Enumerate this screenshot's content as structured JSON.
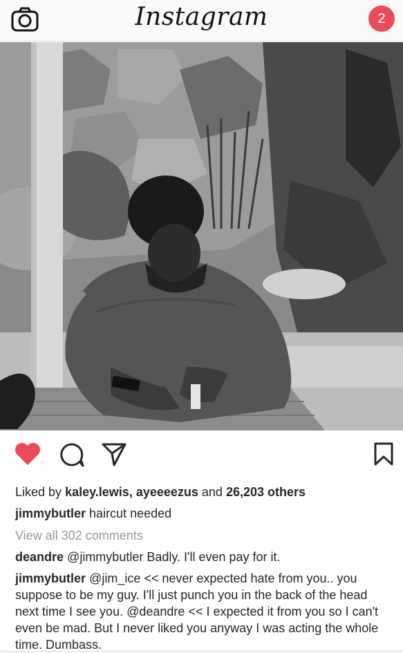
{
  "header": {
    "logo_text": "Instagram",
    "notification_count": "2"
  },
  "icons": {
    "camera": "camera-icon",
    "like": "heart-icon",
    "comment": "comment-icon",
    "share": "send-icon",
    "save": "bookmark-icon"
  },
  "colors": {
    "like_red": "#ed4956",
    "notif_red": "#ed4956"
  },
  "post": {
    "likes": {
      "prefix": "Liked by",
      "user1": "kaley.lewis,",
      "user2": "ayeeeezus",
      "and": "and",
      "count": "26,203 others"
    },
    "caption": {
      "username": "jimmybutler",
      "text": "haircut needed"
    },
    "view_all_comments": "View all 302 comments",
    "comments": [
      {
        "username": "deandre",
        "mention": "@jimmybutler",
        "text": "Badly. I'll even pay for it."
      },
      {
        "username": "jimmybutler",
        "mention": "@jim_ice",
        "text1": "<< never expected hate from you.. you suppose to be my guy. I'll just punch you in the back of the head next time I see you.",
        "mention2": "@deandre",
        "text2": "<< I expected it from you so I can't even be mad. But I never liked you anyway I was acting the whole time. Dumbass."
      }
    ]
  }
}
